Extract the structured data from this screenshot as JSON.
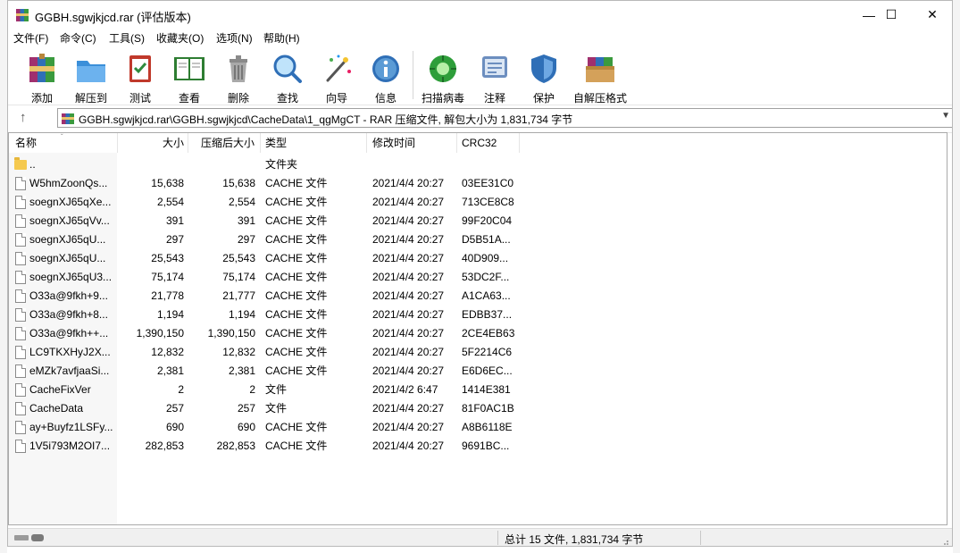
{
  "window": {
    "title": "GGBH.sgwjkjcd.rar (评估版本)",
    "minimize_glyph": "—",
    "maximize_glyph": "☐",
    "close_glyph": "✕"
  },
  "menu": [
    "文件(F)",
    "命令(C)",
    "工具(S)",
    "收藏夹(O)",
    "选项(N)",
    "帮助(H)"
  ],
  "toolbar": [
    {
      "label": "添加",
      "icon": "add-archive-icon"
    },
    {
      "label": "解压到",
      "icon": "extract-folder-icon"
    },
    {
      "label": "测试",
      "icon": "test-clipboard-icon"
    },
    {
      "label": "查看",
      "icon": "view-book-icon"
    },
    {
      "label": "删除",
      "icon": "trash-can-icon"
    },
    {
      "label": "查找",
      "icon": "magnifier-icon"
    },
    {
      "label": "向导",
      "icon": "wizard-wand-icon"
    },
    {
      "label": "信息",
      "icon": "info-icon"
    },
    {
      "label": "扫描病毒",
      "icon": "virus-scan-icon"
    },
    {
      "label": "注释",
      "icon": "comment-icon"
    },
    {
      "label": "保护",
      "icon": "shield-icon"
    },
    {
      "label": "自解压格式",
      "icon": "sfx-box-icon"
    }
  ],
  "address": {
    "up_glyph": "↑",
    "path": "GGBH.sgwjkjcd.rar\\GGBH.sgwjkjcd\\CacheData\\1_qgMgCT - RAR 压缩文件, 解包大小为 1,831,734 字节"
  },
  "columns": {
    "name": "名称",
    "size": "大小",
    "packed": "压缩后大小",
    "type": "类型",
    "modified": "修改时间",
    "crc": "CRC32"
  },
  "files": [
    {
      "name": "..",
      "size": "",
      "packed": "",
      "type": "文件夹",
      "modified": "",
      "crc": "",
      "folder": true
    },
    {
      "name": "W5hmZoonQs...",
      "size": "15,638",
      "packed": "15,638",
      "type": "CACHE 文件",
      "modified": "2021/4/4 20:27",
      "crc": "03EE31C0"
    },
    {
      "name": "soegnXJ65qXe...",
      "size": "2,554",
      "packed": "2,554",
      "type": "CACHE 文件",
      "modified": "2021/4/4 20:27",
      "crc": "713CE8C8"
    },
    {
      "name": "soegnXJ65qVv...",
      "size": "391",
      "packed": "391",
      "type": "CACHE 文件",
      "modified": "2021/4/4 20:27",
      "crc": "99F20C04"
    },
    {
      "name": "soegnXJ65qU...",
      "size": "297",
      "packed": "297",
      "type": "CACHE 文件",
      "modified": "2021/4/4 20:27",
      "crc": "D5B51A..."
    },
    {
      "name": "soegnXJ65qU...",
      "size": "25,543",
      "packed": "25,543",
      "type": "CACHE 文件",
      "modified": "2021/4/4 20:27",
      "crc": "40D909..."
    },
    {
      "name": "soegnXJ65qU3...",
      "size": "75,174",
      "packed": "75,174",
      "type": "CACHE 文件",
      "modified": "2021/4/4 20:27",
      "crc": "53DC2F..."
    },
    {
      "name": "O33a@9fkh+9...",
      "size": "21,778",
      "packed": "21,777",
      "type": "CACHE 文件",
      "modified": "2021/4/4 20:27",
      "crc": "A1CA63..."
    },
    {
      "name": "O33a@9fkh+8...",
      "size": "1,194",
      "packed": "1,194",
      "type": "CACHE 文件",
      "modified": "2021/4/4 20:27",
      "crc": "EDBB37..."
    },
    {
      "name": "O33a@9fkh++...",
      "size": "1,390,150",
      "packed": "1,390,150",
      "type": "CACHE 文件",
      "modified": "2021/4/4 20:27",
      "crc": "2CE4EB63"
    },
    {
      "name": "LC9TKXHyJ2X...",
      "size": "12,832",
      "packed": "12,832",
      "type": "CACHE 文件",
      "modified": "2021/4/4 20:27",
      "crc": "5F2214C6"
    },
    {
      "name": "eMZk7avfjaaSi...",
      "size": "2,381",
      "packed": "2,381",
      "type": "CACHE 文件",
      "modified": "2021/4/4 20:27",
      "crc": "E6D6EC..."
    },
    {
      "name": "CacheFixVer",
      "size": "2",
      "packed": "2",
      "type": "文件",
      "modified": "2021/4/2 6:47",
      "crc": "1414E381"
    },
    {
      "name": "CacheData",
      "size": "257",
      "packed": "257",
      "type": "文件",
      "modified": "2021/4/4 20:27",
      "crc": "81F0AC1B"
    },
    {
      "name": "ay+Buyfz1LSFy...",
      "size": "690",
      "packed": "690",
      "type": "CACHE 文件",
      "modified": "2021/4/4 20:27",
      "crc": "A8B6118E"
    },
    {
      "name": "1V5i793M2OI7...",
      "size": "282,853",
      "packed": "282,853",
      "type": "CACHE 文件",
      "modified": "2021/4/4 20:27",
      "crc": "9691BC..."
    }
  ],
  "status": {
    "summary": "总计 15 文件, 1,831,734 字节"
  }
}
